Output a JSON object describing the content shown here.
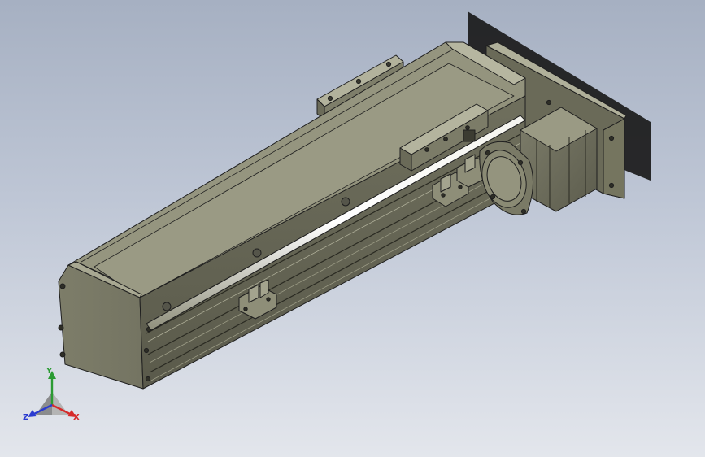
{
  "viewport": {
    "background_top": "#a6b0c2",
    "background_bottom": "#e3e6ec",
    "model_color": "#8a8a74",
    "edge_color": "#1f1f1f"
  },
  "triad": {
    "x_label": "X",
    "y_label": "Y",
    "z_label": "Z",
    "x_color": "#d62a2a",
    "y_color": "#2b9b33",
    "z_color": "#2a3bd0"
  }
}
